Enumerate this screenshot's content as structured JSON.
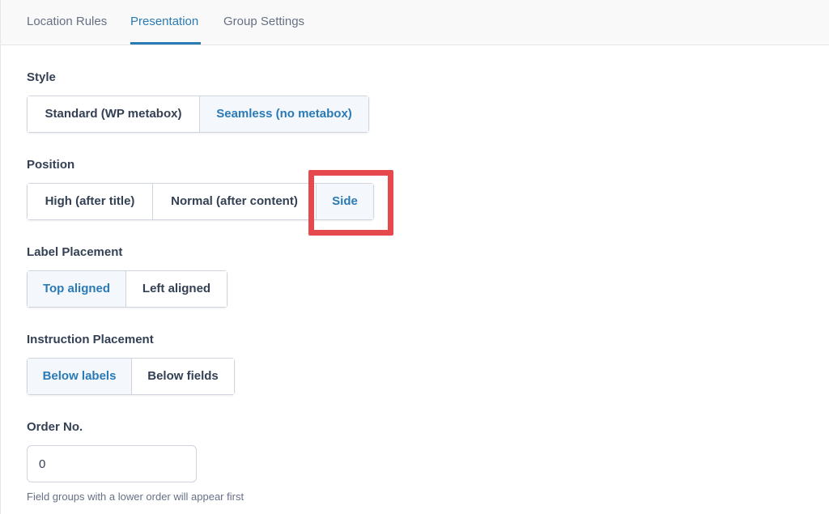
{
  "tabs": [
    {
      "label": "Location Rules",
      "active": false
    },
    {
      "label": "Presentation",
      "active": true
    },
    {
      "label": "Group Settings",
      "active": false
    }
  ],
  "style": {
    "label": "Style",
    "options": [
      "Standard (WP metabox)",
      "Seamless (no metabox)"
    ],
    "selected": "Seamless (no metabox)"
  },
  "position": {
    "label": "Position",
    "options": [
      "High (after title)",
      "Normal (after content)",
      "Side"
    ],
    "selected": "Side"
  },
  "label_placement": {
    "label": "Label Placement",
    "options": [
      "Top aligned",
      "Left aligned"
    ],
    "selected": "Top aligned"
  },
  "instruction_placement": {
    "label": "Instruction Placement",
    "options": [
      "Below labels",
      "Below fields"
    ],
    "selected": "Below labels"
  },
  "order": {
    "label": "Order No.",
    "value": "0",
    "hint": "Field groups with a lower order will appear first"
  },
  "colors": {
    "accent": "#2a7ab6",
    "highlight": "#e5484d"
  }
}
